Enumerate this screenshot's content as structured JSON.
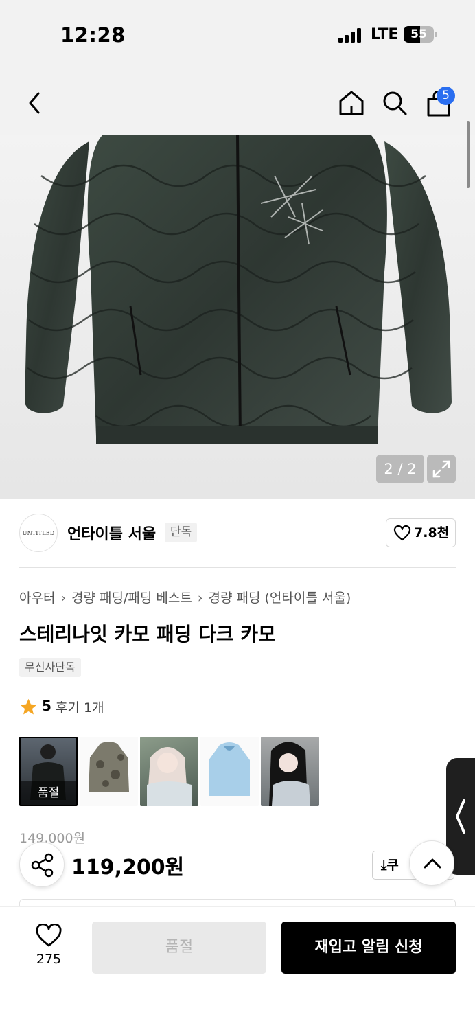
{
  "status_bar": {
    "time": "12:28",
    "network": "LTE",
    "battery": "55",
    "battery_level_percent": 55
  },
  "header": {
    "back_icon": "chevron-left-icon",
    "home_icon": "home-icon",
    "search_icon": "search-icon",
    "cart_icon": "shopping-bag-icon",
    "cart_count": "5"
  },
  "gallery": {
    "pager": "2 / 2",
    "expand_icon": "expand-icon"
  },
  "brand": {
    "logo_text": "UNTITLED",
    "name": "언타이틀 서울",
    "badge": "단독",
    "likes": "7.8천"
  },
  "breadcrumb": [
    "아우터",
    "경량 패딩/패딩 베스트",
    "경량 패딩 (언타이틀 서울)"
  ],
  "product": {
    "title": "스테리나잇 카모 패딩 다크 카모",
    "tag": "무신사단독",
    "rating": "5",
    "review_link": "후기 1개",
    "original_price": "149,000원",
    "price": "119,200원",
    "coupon_label": "쿠"
  },
  "thumbnails": [
    {
      "label": "품절",
      "selected": true
    },
    {
      "label": ""
    },
    {
      "label": ""
    },
    {
      "label": ""
    },
    {
      "label": ""
    }
  ],
  "bottom_bar": {
    "like_count": "275",
    "soldout_label": "품절",
    "notify_label": "재입고 알림 신청"
  },
  "colors": {
    "accent_blue": "#2a6ef0",
    "star": "#f5a623",
    "primary_button": "#000000"
  }
}
